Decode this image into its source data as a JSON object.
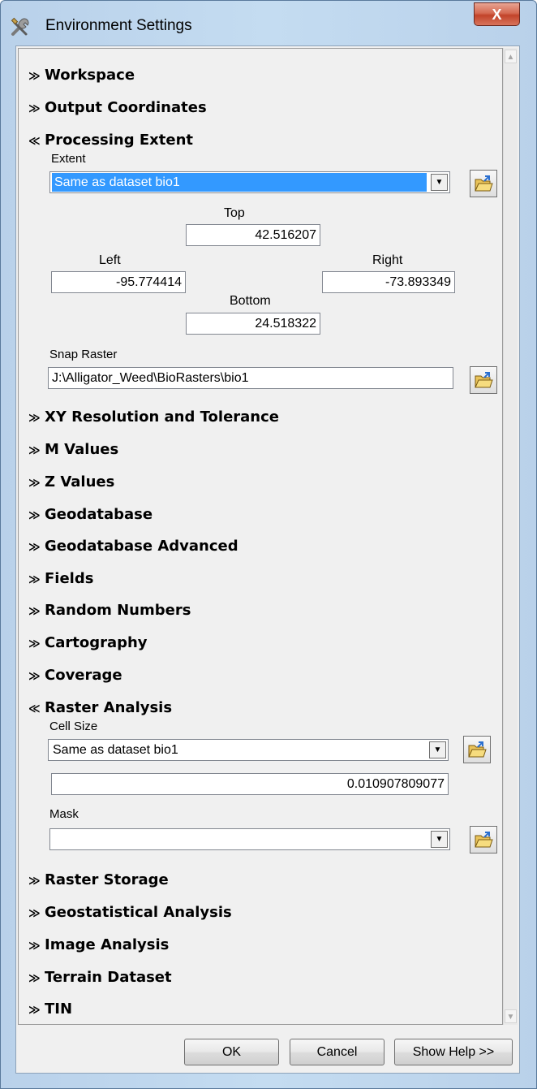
{
  "window": {
    "title": "Environment Settings",
    "close_glyph": "X"
  },
  "sections": {
    "workspace": "Workspace",
    "output_coordinates": "Output Coordinates",
    "processing_extent": "Processing Extent",
    "xy_resolution": "XY Resolution and Tolerance",
    "m_values": "M Values",
    "z_values": "Z Values",
    "geodatabase": "Geodatabase",
    "geodatabase_advanced": "Geodatabase Advanced",
    "fields": "Fields",
    "random_numbers": "Random Numbers",
    "cartography": "Cartography",
    "coverage": "Coverage",
    "raster_analysis": "Raster Analysis",
    "raster_storage": "Raster Storage",
    "geostatistical_analysis": "Geostatistical Analysis",
    "image_analysis": "Image Analysis",
    "terrain_dataset": "Terrain Dataset",
    "tin": "TIN"
  },
  "chevrons": {
    "collapsed": "❯❯",
    "expanded": "❯❯"
  },
  "processing_extent": {
    "extent_label": "Extent",
    "extent_value": "Same as dataset bio1",
    "top_label": "Top",
    "top_value": "42.516207",
    "left_label": "Left",
    "left_value": "-95.774414",
    "right_label": "Right",
    "right_value": "-73.893349",
    "bottom_label": "Bottom",
    "bottom_value": "24.518322",
    "snap_raster_label": "Snap Raster",
    "snap_raster_value": "J:\\Alligator_Weed\\BioRasters\\bio1"
  },
  "raster_analysis": {
    "cell_size_label": "Cell Size",
    "cell_size_option": "Same as dataset bio1",
    "cell_size_value": "0.010907809077",
    "mask_label": "Mask",
    "mask_value": ""
  },
  "buttons": {
    "ok": "OK",
    "cancel": "Cancel",
    "show_help": "Show Help >>"
  }
}
